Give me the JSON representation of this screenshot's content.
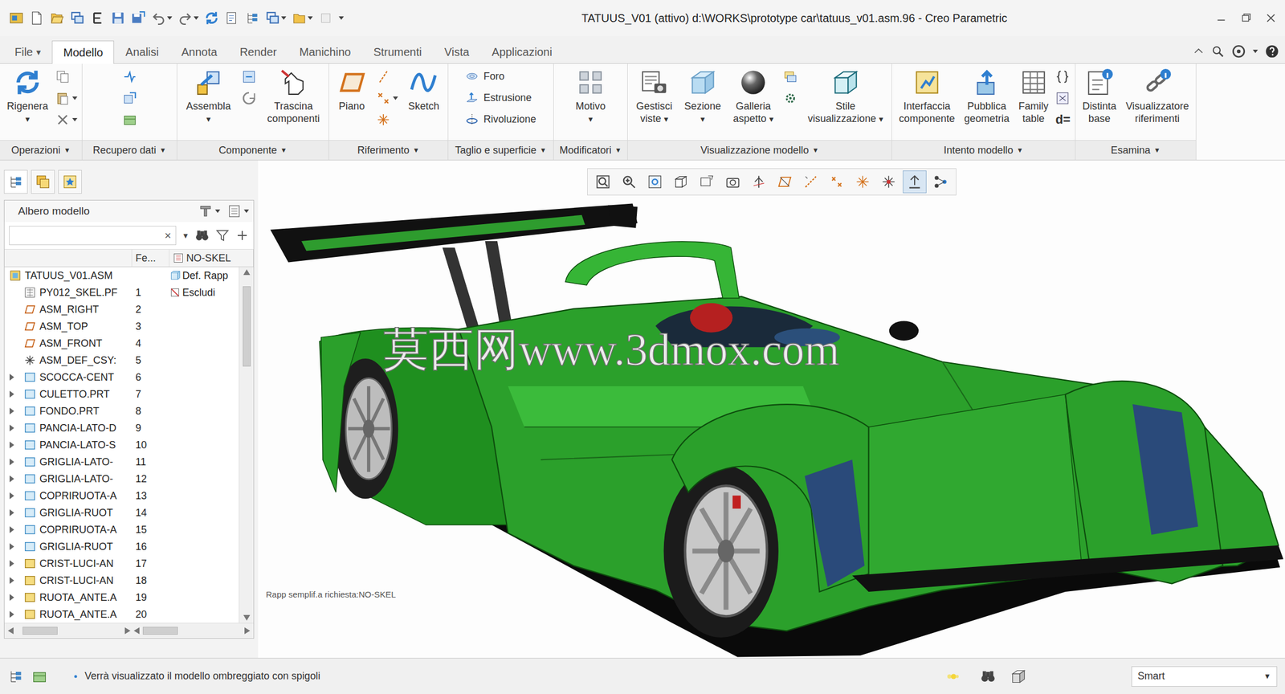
{
  "window": {
    "title": "TATUUS_V01 (attivo) d:\\WORKS\\prototype car\\tatuus_v01.asm.96 - Creo Parametric"
  },
  "tabs": [
    {
      "label": "File",
      "selected": false,
      "arrow": "▾"
    },
    {
      "label": "Modello",
      "selected": true
    },
    {
      "label": "Analisi",
      "selected": false
    },
    {
      "label": "Annota",
      "selected": false
    },
    {
      "label": "Render",
      "selected": false
    },
    {
      "label": "Manichino",
      "selected": false
    },
    {
      "label": "Strumenti",
      "selected": false
    },
    {
      "label": "Vista",
      "selected": false
    },
    {
      "label": "Applicazioni",
      "selected": false
    }
  ],
  "ribbon": {
    "groups": [
      {
        "label": "Operazioni",
        "arrow": "▼",
        "buttons": [
          {
            "kind": "large",
            "lines": [
              "Rigenera"
            ],
            "arrow": "▾"
          }
        ]
      },
      {
        "label": "Recupero dati",
        "arrow": "▼",
        "buttons": []
      },
      {
        "label": "Componente",
        "arrow": "▼",
        "buttons": [
          {
            "kind": "large",
            "lines": [
              "Assembla"
            ],
            "arrow": "▾"
          },
          {
            "kind": "large",
            "lines": [
              "Trascina",
              "componenti"
            ]
          }
        ]
      },
      {
        "label": "Riferimento",
        "arrow": "▼",
        "buttons": [
          {
            "kind": "large",
            "lines": [
              "Piano"
            ]
          },
          {
            "kind": "large",
            "lines": [
              "Sketch"
            ]
          }
        ]
      },
      {
        "label": "Taglio e superficie",
        "arrow": "▼",
        "buttons": [
          {
            "kind": "small",
            "lines": [
              "Foro"
            ]
          },
          {
            "kind": "small",
            "lines": [
              "Estrusione"
            ]
          },
          {
            "kind": "small",
            "lines": [
              "Rivoluzione"
            ]
          }
        ]
      },
      {
        "label": "Modificatori",
        "arrow": "▼",
        "buttons": [
          {
            "kind": "large",
            "lines": [
              "Motivo"
            ],
            "arrow": "▾"
          }
        ]
      },
      {
        "label": "Visualizzazione modello",
        "arrow": "▼",
        "buttons": [
          {
            "kind": "large",
            "lines": [
              "Gestisci",
              "viste"
            ],
            "arrow": "▾"
          },
          {
            "kind": "large",
            "lines": [
              "Sezione"
            ],
            "arrow": "▾"
          },
          {
            "kind": "large",
            "lines": [
              "Galleria",
              "aspetto"
            ],
            "arrow": "▾"
          },
          {
            "kind": "large",
            "lines": [
              "Stile",
              "visualizzazione"
            ],
            "arrow": "▾"
          }
        ]
      },
      {
        "label": "Intento modello",
        "arrow": "▼",
        "buttons": [
          {
            "kind": "large",
            "lines": [
              "Interfaccia",
              "componente"
            ]
          },
          {
            "kind": "large",
            "lines": [
              "Pubblica",
              "geometria"
            ]
          },
          {
            "kind": "large",
            "lines": [
              "Family",
              "table"
            ]
          }
        ],
        "small_text": "d="
      },
      {
        "label": "Esamina",
        "arrow": "▼",
        "buttons": [
          {
            "kind": "large",
            "lines": [
              "Distinta",
              "base"
            ]
          },
          {
            "kind": "large",
            "lines": [
              "Visualizzatore",
              "riferimenti"
            ]
          }
        ]
      }
    ]
  },
  "tree": {
    "title": "Albero modello",
    "search": {
      "clear": "×",
      "arrow": "▼"
    },
    "columns": {
      "fe": "Fe...",
      "rep": "NO-SKEL"
    },
    "rows": [
      {
        "name": "TATUUS_V01.ASM",
        "kind": "assembly",
        "expandable": false,
        "rep": "Def. Rapp",
        "rep_kind": "default"
      },
      {
        "name": "PY012_SKEL.PF",
        "num": "1",
        "kind": "skeleton",
        "expandable": false,
        "rep": "Escludi",
        "rep_kind": "exclude"
      },
      {
        "name": "ASM_RIGHT",
        "num": "2",
        "kind": "datum",
        "expandable": false
      },
      {
        "name": "ASM_TOP",
        "num": "3",
        "kind": "datum",
        "expandable": false
      },
      {
        "name": "ASM_FRONT",
        "num": "4",
        "kind": "datum",
        "expandable": false
      },
      {
        "name": "ASM_DEF_CSY:",
        "num": "5",
        "kind": "csys",
        "expandable": false
      },
      {
        "name": "SCOCCA-CENT",
        "num": "6",
        "kind": "part",
        "expandable": true,
        "expanded": false
      },
      {
        "name": "CULETTO.PRT",
        "num": "7",
        "kind": "part",
        "expandable": true,
        "expanded": false
      },
      {
        "name": "FONDO.PRT",
        "num": "8",
        "kind": "part",
        "expandable": true,
        "expanded": false
      },
      {
        "name": "PANCIA-LATO-D",
        "num": "9",
        "kind": "part",
        "expandable": true,
        "expanded": false
      },
      {
        "name": "PANCIA-LATO-S",
        "num": "10",
        "kind": "part",
        "expandable": true,
        "expanded": false
      },
      {
        "name": "GRIGLIA-LATO-",
        "num": "11",
        "kind": "part",
        "expandable": true,
        "expanded": false
      },
      {
        "name": "GRIGLIA-LATO-",
        "num": "12",
        "kind": "part",
        "expandable": true,
        "expanded": false
      },
      {
        "name": "COPRIRUOTA-A",
        "num": "13",
        "kind": "part",
        "expandable": true,
        "expanded": false
      },
      {
        "name": "GRIGLIA-RUOT",
        "num": "14",
        "kind": "part",
        "expandable": true,
        "expanded": false
      },
      {
        "name": "COPRIRUOTA-A",
        "num": "15",
        "kind": "part",
        "expandable": true,
        "expanded": false
      },
      {
        "name": "GRIGLIA-RUOT",
        "num": "16",
        "kind": "part",
        "expandable": true,
        "expanded": false
      },
      {
        "name": "CRIST-LUCI-AN",
        "num": "17",
        "kind": "subassembly",
        "expandable": true,
        "expanded": false
      },
      {
        "name": "CRIST-LUCI-AN",
        "num": "18",
        "kind": "subassembly",
        "expandable": true,
        "expanded": false
      },
      {
        "name": "RUOTA_ANTE.A",
        "num": "19",
        "kind": "subassembly",
        "expandable": true,
        "expanded": false
      },
      {
        "name": "RUOTA_ANTE.A",
        "num": "20",
        "kind": "subassembly",
        "expandable": true,
        "expanded": false
      }
    ]
  },
  "view_toolbar": [
    {
      "pressed": false
    },
    {
      "pressed": false
    },
    {
      "pressed": false
    },
    {
      "pressed": false
    },
    {
      "pressed": false
    },
    {
      "pressed": false
    },
    {
      "pressed": false
    },
    {
      "pressed": false
    },
    {
      "pressed": false
    },
    {
      "pressed": false
    },
    {
      "pressed": false
    },
    {
      "pressed": false
    },
    {
      "pressed": true
    },
    {
      "pressed": false
    }
  ],
  "canvas": {
    "rep_label": "Rapp semplif.a richiesta:NO-SKEL",
    "watermark": "莫西网www.3dmox.com"
  },
  "status_bar": {
    "message": "Verrà visualizzato il modello ombreggiato con spigoli",
    "filter": {
      "value": "Smart",
      "arrow": "▼"
    }
  }
}
